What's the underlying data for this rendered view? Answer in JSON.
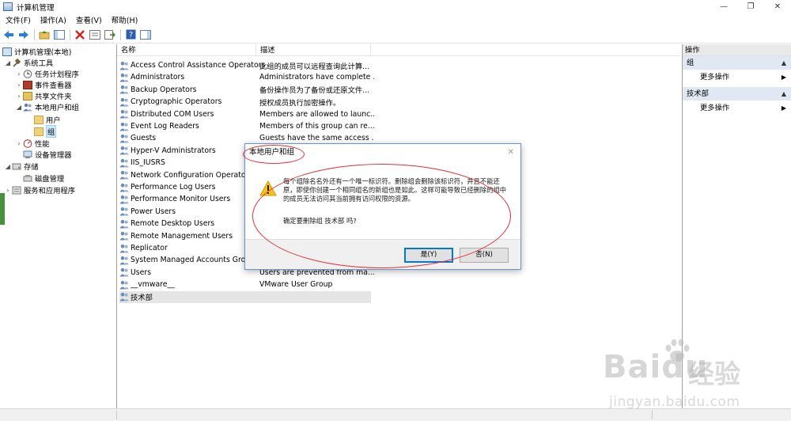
{
  "window": {
    "title": "计算机管理",
    "controls": [
      "minimize-icon",
      "restore-icon",
      "close-icon"
    ]
  },
  "menu": [
    "文件(F)",
    "操作(A)",
    "查看(V)",
    "帮助(H)"
  ],
  "tree": {
    "root": "计算机管理(本地)",
    "items": [
      {
        "label": "系统工具"
      },
      {
        "label": "任务计划程序"
      },
      {
        "label": "事件查看器"
      },
      {
        "label": "共享文件夹"
      },
      {
        "label": "本地用户和组"
      },
      {
        "label": "用户"
      },
      {
        "label": "组"
      },
      {
        "label": "性能"
      },
      {
        "label": "设备管理器"
      },
      {
        "label": "存储"
      },
      {
        "label": "磁盘管理"
      },
      {
        "label": "服务和应用程序"
      }
    ]
  },
  "list": {
    "columns": [
      "名称",
      "描述"
    ],
    "rows": [
      {
        "name": "Access Control Assistance Operators",
        "desc": "此组的成员可以远程查询此计算..."
      },
      {
        "name": "Administrators",
        "desc": "Administrators have complete ..."
      },
      {
        "name": "Backup Operators",
        "desc": "备份操作员为了备份或还原文件..."
      },
      {
        "name": "Cryptographic Operators",
        "desc": "授权成员执行加密操作。"
      },
      {
        "name": "Distributed COM Users",
        "desc": "Members are allowed to launc..."
      },
      {
        "name": "Event Log Readers",
        "desc": "Members of this group can re..."
      },
      {
        "name": "Guests",
        "desc": "Guests have the same access ..."
      },
      {
        "name": "Hyper-V Administrators",
        "desc": ""
      },
      {
        "name": "IIS_IUSRS",
        "desc": ""
      },
      {
        "name": "Network Configuration Operators",
        "desc": ""
      },
      {
        "name": "Performance Log Users",
        "desc": ""
      },
      {
        "name": "Performance Monitor Users",
        "desc": ""
      },
      {
        "name": "Power Users",
        "desc": ""
      },
      {
        "name": "Remote Desktop Users",
        "desc": ""
      },
      {
        "name": "Remote Management Users",
        "desc": ""
      },
      {
        "name": "Replicator",
        "desc": ""
      },
      {
        "name": "System Managed Accounts Group",
        "desc": ""
      },
      {
        "name": "Users",
        "desc": "Users are prevented from ma..."
      },
      {
        "name": "__vmware__",
        "desc": "VMware User Group"
      },
      {
        "name": "技术部",
        "desc": ""
      }
    ]
  },
  "actions": {
    "header": "操作",
    "sections": [
      {
        "title": "组",
        "item": "更多操作"
      },
      {
        "title": "技术部",
        "item": "更多操作"
      }
    ]
  },
  "dialog": {
    "title": "本地用户和组",
    "message": "每个组除名名外还有一个唯一标识符。删除组会删除该标识符，并且不能还原，即使你创建一个相同组名的新组也是如此。这样可能导致已经删除的组中的成员无法访问其当前拥有访问权限的资源。",
    "confirm": "确定要删除组 技术部 吗?",
    "yes": "是(Y)",
    "no": "否(N)"
  },
  "watermark": {
    "brand": "Baidu",
    "text": "经验",
    "url": "jingyan.baidu.com"
  },
  "colors": {
    "annotation": "#e0303a",
    "selection": "#cce8ff",
    "dialog_border": "#6a93c9",
    "default_button": "#0078d7"
  }
}
